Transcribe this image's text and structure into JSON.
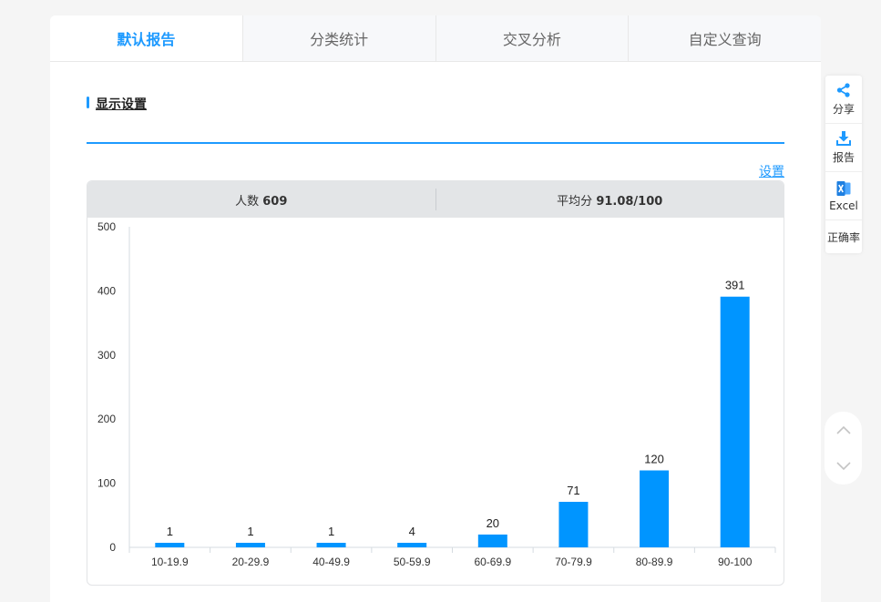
{
  "tabs": [
    {
      "label": "默认报告"
    },
    {
      "label": "分类统计"
    },
    {
      "label": "交叉分析"
    },
    {
      "label": "自定义查询"
    }
  ],
  "section": {
    "title": "显示设置",
    "settings_link": "设置"
  },
  "stats": {
    "count_label": "人数",
    "count_value": "609",
    "avg_label": "平均分",
    "avg_value": "91.08/100"
  },
  "sidebar": {
    "share": "分享",
    "report": "报告",
    "excel": "Excel",
    "accuracy": "正确率"
  },
  "colors": {
    "accent": "#1e9aff",
    "bar": "#0095ff"
  },
  "chart_data": {
    "type": "bar",
    "categories": [
      "10-19.9",
      "20-29.9",
      "40-49.9",
      "50-59.9",
      "60-69.9",
      "70-79.9",
      "80-89.9",
      "90-100"
    ],
    "values": [
      1,
      1,
      1,
      4,
      20,
      71,
      120,
      391
    ],
    "ylim": [
      0,
      500
    ],
    "yticks": [
      0,
      100,
      200,
      300,
      400,
      500
    ],
    "data_labels": true,
    "grid": false
  }
}
